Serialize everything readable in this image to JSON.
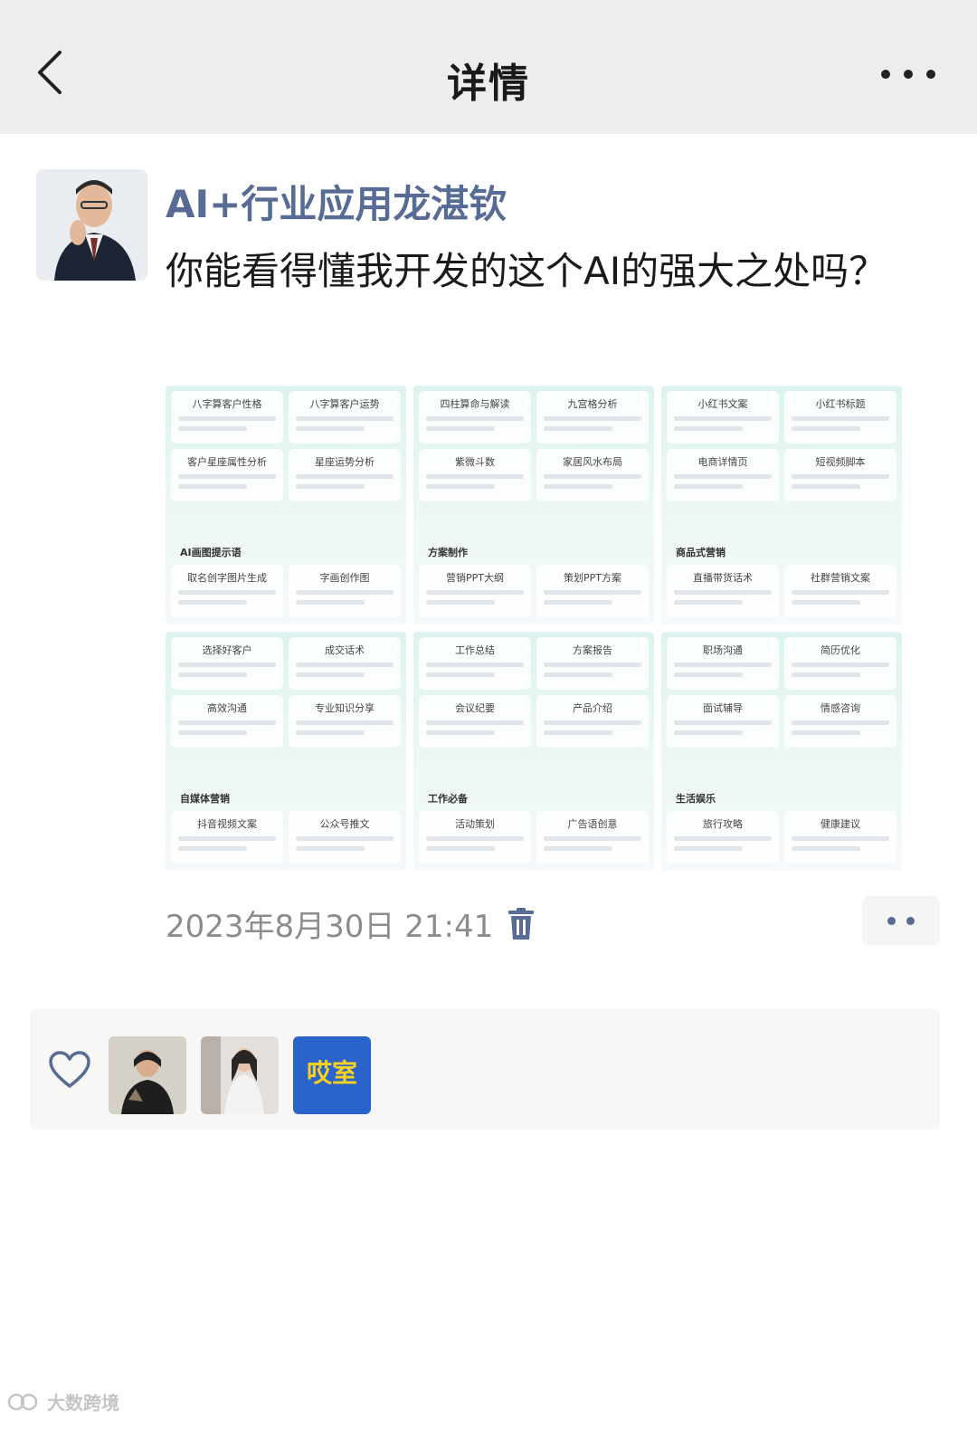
{
  "header": {
    "title": "详情",
    "back_icon": "chevron-left-icon",
    "more_icon": "ellipsis-icon"
  },
  "post": {
    "author": "AI+行业应用龙湛钦",
    "text": "你能看得懂我开发的这个AI的强大之处吗？",
    "timestamp": "2023年8月30日 21:41",
    "delete_icon": "trash-icon",
    "action_icon": "comment-like-menu-icon"
  },
  "screenshot": {
    "panels": [
      {
        "cards": [
          "八字算客户性格",
          "八字算客户运势",
          "客户星座属性分析",
          "星座运势分析"
        ],
        "section": "AI画图提示语",
        "cards2": [
          "取名创字图片生成",
          "字画创作图"
        ]
      },
      {
        "cards": [
          "四柱算命与解读",
          "九宫格分析",
          "紫微斗数",
          "家居风水布局"
        ],
        "section": "方案制作",
        "cards2": [
          "营销PPT大纲",
          "策划PPT方案"
        ]
      },
      {
        "cards": [
          "小红书文案",
          "小红书标题",
          "电商详情页",
          "短视频脚本"
        ],
        "section": "商品式营销",
        "cards2": [
          "直播带货话术",
          "社群营销文案"
        ]
      },
      {
        "cards": [
          "选择好客户",
          "成交话术",
          "高效沟通",
          "专业知识分享"
        ],
        "section": "自媒体营销",
        "cards2": [
          "抖音视频文案",
          "公众号推文"
        ]
      },
      {
        "cards": [
          "工作总结",
          "方案报告",
          "会议纪要",
          "产品介绍"
        ],
        "section": "工作必备",
        "cards2": [
          "活动策划",
          "广告语创意"
        ]
      },
      {
        "cards": [
          "职场沟通",
          "简历优化",
          "面试辅导",
          "情感咨询"
        ],
        "section": "生活娱乐",
        "cards2": [
          "旅行攻略",
          "健康建议"
        ]
      }
    ]
  },
  "likes": {
    "heart_icon": "heart-outline-icon",
    "avatars": [
      {
        "name": "liker-avatar-1"
      },
      {
        "name": "liker-avatar-2"
      },
      {
        "name": "liker-avatar-3",
        "logo_text": "哎室"
      }
    ]
  },
  "watermark": "大数跨境"
}
